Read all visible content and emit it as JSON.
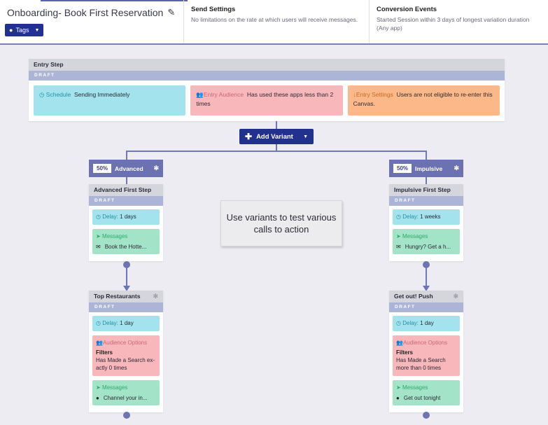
{
  "header": {
    "title": "Onboarding- Book First Reservation",
    "tags_label": "Tags",
    "send_settings": {
      "heading": "Send Settings",
      "text": "No limitations on the rate at which users will receive messages."
    },
    "conversion_events": {
      "heading": "Conversion Events",
      "text": "Started Session within 3 days of longest variation duration (Any app)"
    }
  },
  "entry_step": {
    "title": "Entry Step",
    "status": "DRAFT",
    "schedule_label": "Schedule",
    "schedule_value": "Sending Immediately",
    "audience_label": "Entry Audience",
    "audience_value": "Has used these apps less than 2 times",
    "settings_label": "Entry Settings",
    "settings_value": "Users are not eligible to re-enter this Canvas."
  },
  "add_variant_label": "Add Variant",
  "tooltip_text": "Use variants to test various calls to action",
  "variants": [
    {
      "percent": "50%",
      "name": "Advanced",
      "steps": [
        {
          "title": "Advanced First Step",
          "status": "DRAFT",
          "delay_label": "Delay:",
          "delay_value": "1 days",
          "messages_label": "Messages",
          "message_text": "Book the Hotte..."
        },
        {
          "title": "Top Restaurants",
          "status": "DRAFT",
          "delay_label": "Delay:",
          "delay_value": "1 day",
          "audience_label": "Audience Options",
          "filters_label": "Filters",
          "filters_text": "Has Made a Search ex- actly 0 times",
          "messages_label": "Messages",
          "message_text": "Channel your in..."
        }
      ]
    },
    {
      "percent": "50%",
      "name": "Impulsive",
      "steps": [
        {
          "title": "Impulsive First Step",
          "status": "DRAFT",
          "delay_label": "Delay:",
          "delay_value": "1 weeks",
          "messages_label": "Messages",
          "message_text": "Hungry? Get a h..."
        },
        {
          "title": "Get out! Push",
          "status": "DRAFT",
          "delay_label": "Delay:",
          "delay_value": "1 day",
          "audience_label": "Audience Options",
          "filters_label": "Filters",
          "filters_text": "Has Made a Search more than 0 times",
          "messages_label": "Messages",
          "message_text": "Get out tonight"
        }
      ]
    }
  ],
  "colors": {
    "primary": "#23318e",
    "variant_header": "#6c72b1",
    "delay_tile": "#a2e3ed",
    "message_tile": "#a3e4c8",
    "audience_tile": "#f8b7ba",
    "settings_tile": "#fdb88a",
    "draft_bar": "#adb5d7"
  },
  "icons": {
    "edit": "pencil-icon",
    "tag": "tag-icon",
    "schedule": "clock-icon",
    "audience": "users-icon",
    "settings": "arrow-down-icon",
    "messages": "paper-plane-icon",
    "email": "envelope-icon",
    "push": "apple-icon",
    "gear": "gear-icon"
  }
}
